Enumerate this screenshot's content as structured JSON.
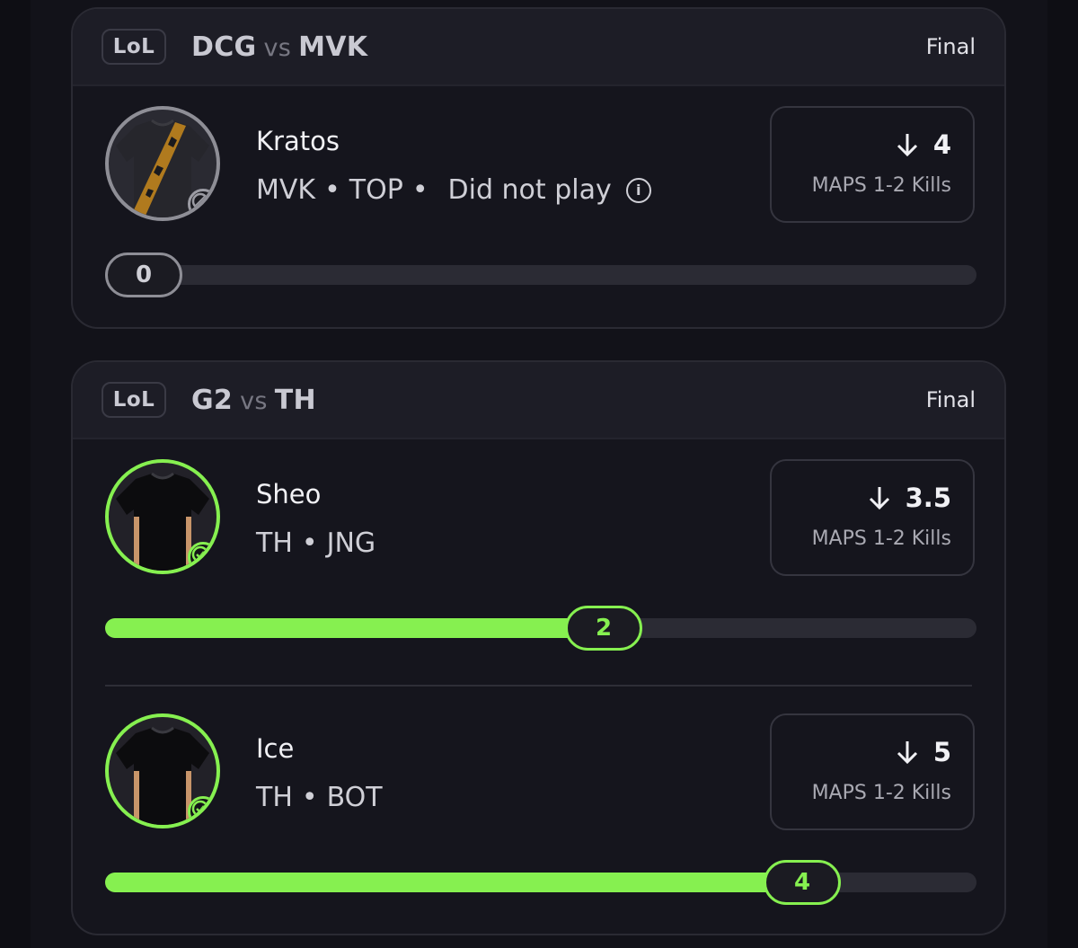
{
  "cards": [
    {
      "league": "LoL",
      "team_a": "DCG",
      "vs": "vs",
      "team_b": "MVK",
      "status": "Final",
      "players": [
        {
          "name": "Kratos",
          "team": "MVK",
          "position": "TOP",
          "note": "Did not play",
          "line_value": "4",
          "line_label": "MAPS 1-2 Kills",
          "result": "0",
          "result_fraction": 0
        }
      ]
    },
    {
      "league": "LoL",
      "team_a": "G2",
      "vs": "vs",
      "team_b": "TH",
      "status": "Final",
      "players": [
        {
          "name": "Sheo",
          "team": "TH",
          "position": "JNG",
          "line_value": "3.5",
          "line_label": "MAPS 1-2 Kills",
          "result": "2",
          "result_fraction": 0.57
        },
        {
          "name": "Ice",
          "team": "TH",
          "position": "BOT",
          "line_value": "5",
          "line_label": "MAPS 1-2 Kills",
          "result": "4",
          "result_fraction": 0.8
        }
      ]
    }
  ],
  "colors": {
    "accent": "#86f050",
    "background": "#121219",
    "card": "#15151d"
  },
  "icons": {
    "direction": "arrow-down-icon",
    "dnp": "block-icon",
    "played": "check-icon",
    "info": "info-icon"
  }
}
